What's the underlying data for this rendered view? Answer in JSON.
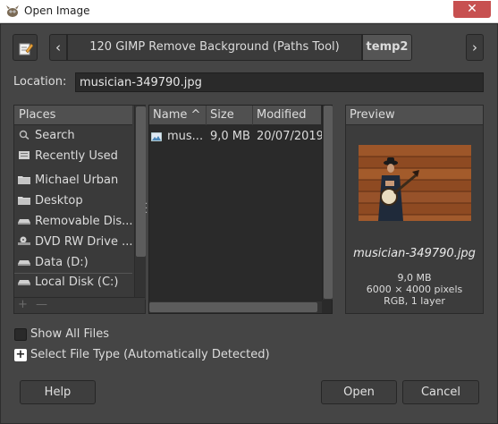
{
  "window": {
    "title": "Open Image",
    "close_glyph": "✕"
  },
  "pathbar": {
    "edit_icon": "edit-location-icon",
    "crumbs": [
      "120 GIMP Remove Background (Paths Tool)",
      "temp2"
    ],
    "left_arrow": "‹",
    "right_arrow": "›"
  },
  "location": {
    "label": "Location:",
    "value": "musician-349790.jpg"
  },
  "places": {
    "header": "Places",
    "items": [
      {
        "label": "Search",
        "icon": "search-icon"
      },
      {
        "label": "Recently Used",
        "icon": "recent-icon"
      },
      {
        "label": "Michael Urban",
        "icon": "folder-icon"
      },
      {
        "label": "Desktop",
        "icon": "folder-icon"
      },
      {
        "label": "Removable Dis...",
        "icon": "drive-icon"
      },
      {
        "label": "DVD RW Drive ...",
        "icon": "optical-drive-icon"
      },
      {
        "label": "Data (D:)",
        "icon": "drive-icon"
      },
      {
        "label": "Local Disk (C:)",
        "icon": "drive-icon"
      }
    ],
    "add_glyph": "+",
    "remove_glyph": "—"
  },
  "files": {
    "columns": {
      "name": "Name",
      "sort_glyph": "^",
      "size": "Size",
      "modified": "Modified"
    },
    "rows": [
      {
        "name": "mus...",
        "size": "9,0 MB",
        "modified": "20/07/2019"
      }
    ]
  },
  "preview": {
    "header": "Preview",
    "filename": "musician-349790.jpg",
    "size": "9,0 MB",
    "dimensions": "6000 × 4000 pixels",
    "mode": "RGB, 1 layer"
  },
  "options": {
    "show_all_files": "Show All Files",
    "show_all_checked": false,
    "file_type": "Select File Type (Automatically Detected)",
    "expander_glyph": "+"
  },
  "buttons": {
    "help": "Help",
    "open": "Open",
    "cancel": "Cancel"
  }
}
